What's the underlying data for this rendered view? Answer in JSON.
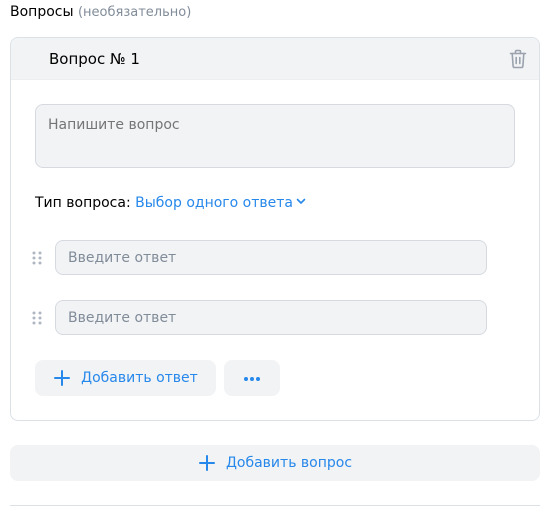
{
  "section": {
    "title": "Вопросы",
    "optional": "(необязательно)"
  },
  "question": {
    "title": "Вопрос № 1",
    "placeholder": "Напишите вопрос",
    "type_label": "Тип вопроса:",
    "type_value": "Выбор одного ответа",
    "answers": [
      {
        "placeholder": "Введите ответ"
      },
      {
        "placeholder": "Введите ответ"
      }
    ],
    "add_answer_label": "Добавить ответ",
    "more_label": "•••"
  },
  "add_question_label": "Добавить вопрос",
  "icons": {
    "trash": "trash-icon",
    "chevron": "chevron-down-icon",
    "drag": "drag-handle-icon",
    "plus": "plus-icon",
    "more": "more-horizontal-icon"
  },
  "colors": {
    "accent": "#2688eb",
    "muted": "#818c99",
    "field_bg": "#f2f3f5",
    "border": "#dce1e6"
  }
}
